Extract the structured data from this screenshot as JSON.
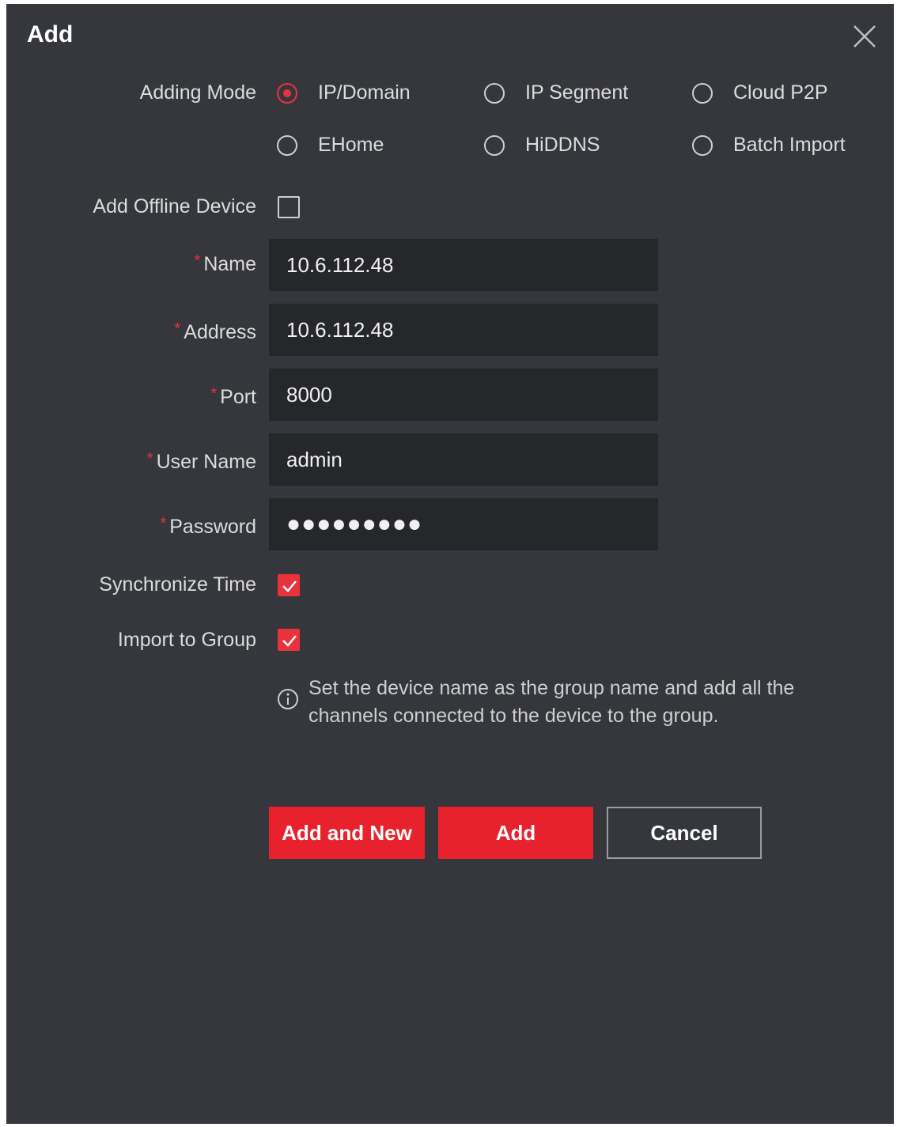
{
  "dialog": {
    "title": "Add",
    "close_icon": "close-icon"
  },
  "adding_mode": {
    "label": "Adding Mode",
    "selected": "IP/Domain",
    "options": [
      "IP/Domain",
      "IP Segment",
      "Cloud P2P",
      "EHome",
      "HiDDNS",
      "Batch Import"
    ]
  },
  "offline_device": {
    "label": "Add Offline Device",
    "checked": false
  },
  "fields": {
    "required_mark": "*",
    "name": {
      "label": "Name",
      "value": "10.6.112.48"
    },
    "address": {
      "label": "Address",
      "value": "10.6.112.48"
    },
    "port": {
      "label": "Port",
      "value": "8000"
    },
    "user_name": {
      "label": "User Name",
      "value": "admin"
    },
    "password": {
      "label": "Password",
      "value": "●●●●●●●●●"
    }
  },
  "synchronize_time": {
    "label": "Synchronize Time",
    "checked": true
  },
  "import_to_group": {
    "label": "Import to Group",
    "checked": true
  },
  "hint": {
    "icon": "info-icon",
    "text": "Set the device name as the group name and add all the channels connected to the device to the group."
  },
  "buttons": {
    "add_and_new": "Add and New",
    "add": "Add",
    "cancel": "Cancel"
  },
  "colors": {
    "background": "#35373c",
    "accent": "#e8222c",
    "field_bg": "#26272b"
  }
}
